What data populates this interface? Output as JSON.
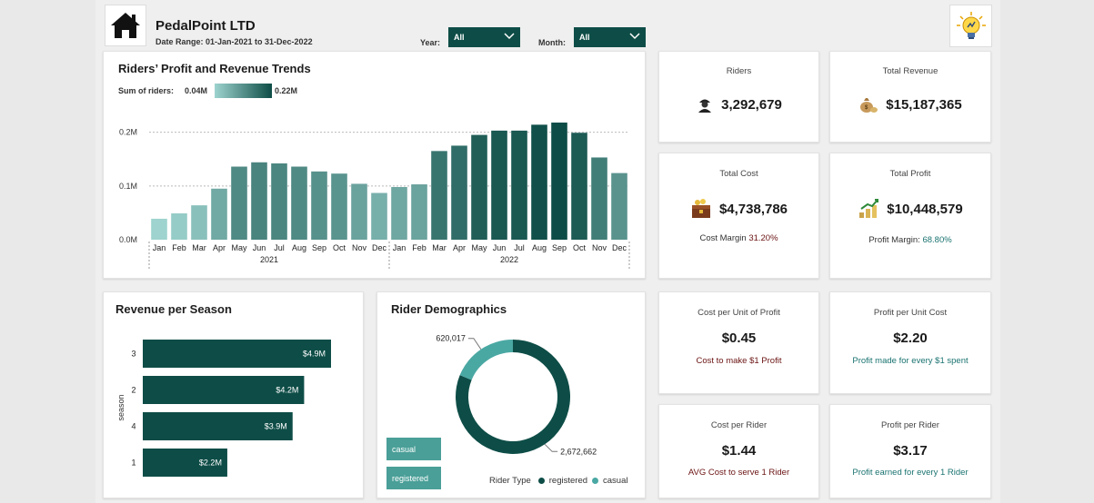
{
  "header": {
    "company": "PedalPoint LTD",
    "date_range": "Date Range: 01-Jan-2021 to 31-Dec-2022",
    "year_label": "Year:",
    "year_value": "All",
    "month_label": "Month:",
    "month_value": "All"
  },
  "trend": {
    "title": "Riders’ Profit and Revenue Trends",
    "legend_label": "Sum of riders:",
    "legend_min": "0.04M",
    "legend_max": "0.22M"
  },
  "kpis": {
    "riders": {
      "label": "Riders",
      "value": "3,292,679"
    },
    "total_revenue": {
      "label": "Total Revenue",
      "value": "$15,187,365"
    },
    "total_cost": {
      "label": "Total Cost",
      "value": "$4,738,786",
      "sub_label": "Cost Margin",
      "sub_value": "31.20%"
    },
    "total_profit": {
      "label": "Total Profit",
      "value": "$10,448,579",
      "sub_label": "Profit Margin:",
      "sub_value": "68.80%"
    },
    "cost_per_profit": {
      "label": "Cost per Unit of Profit",
      "value": "$0.45",
      "sub": "Cost to make $1 Profit"
    },
    "profit_per_cost": {
      "label": "Profit per Unit Cost",
      "value": "$2.20",
      "sub": "Profit made for every $1 spent"
    },
    "cost_per_rider": {
      "label": "Cost per Rider",
      "value": "$1.44",
      "sub": "AVG Cost to serve 1 Rider"
    },
    "profit_per_rider": {
      "label": "Profit per Rider",
      "value": "$3.17",
      "sub": "Profit earned for every 1 Rider"
    }
  },
  "season": {
    "title": "Revenue per Season",
    "axis_label": "season"
  },
  "demographics": {
    "title": "Rider Demographics",
    "buttons": [
      "casual",
      "registered"
    ],
    "legend_title": "Rider Type",
    "legend_items": [
      "registered",
      "casual"
    ]
  },
  "colors": {
    "dark_teal": "#0e4d47",
    "mid_teal": "#4a9f98",
    "light_teal": "#8fcfca",
    "teal_text": "#1a7370",
    "maroon_text": "#6b1313"
  },
  "icons": {
    "home": "home-icon",
    "bulb": "lightbulb-icon",
    "riders": "rider-icon",
    "revenue": "money-bag-icon",
    "cost": "treasure-chest-icon",
    "profit": "growth-icon"
  },
  "chart_data": [
    {
      "type": "bar",
      "title": "Riders’ Profit and Revenue Trends",
      "x": [
        "Jan",
        "Feb",
        "Mar",
        "Apr",
        "May",
        "Jun",
        "Jul",
        "Aug",
        "Sep",
        "Oct",
        "Nov",
        "Dec",
        "Jan",
        "Feb",
        "Mar",
        "Apr",
        "May",
        "Jun",
        "Jul",
        "Aug",
        "Sep",
        "Oct",
        "Nov",
        "Dec"
      ],
      "groups": [
        "2021",
        "2022"
      ],
      "values": [
        0.039,
        0.049,
        0.064,
        0.095,
        0.136,
        0.144,
        0.142,
        0.136,
        0.127,
        0.123,
        0.104,
        0.087,
        0.098,
        0.103,
        0.165,
        0.175,
        0.195,
        0.203,
        0.203,
        0.214,
        0.218,
        0.199,
        0.153,
        0.124
      ],
      "y_ticks": [
        "0.0M",
        "0.1M",
        "0.2M"
      ],
      "ylim": [
        0,
        0.245
      ],
      "grid": true
    },
    {
      "type": "bar",
      "orientation": "horizontal",
      "title": "Revenue per Season",
      "ylabel": "season",
      "categories": [
        "3",
        "2",
        "4",
        "1"
      ],
      "values": [
        4.9,
        4.2,
        3.9,
        2.2
      ],
      "labels": [
        "$4.9M",
        "$4.2M",
        "$3.9M",
        "$2.2M"
      ]
    },
    {
      "type": "pie",
      "donut": true,
      "title": "Rider Demographics",
      "labels": [
        "registered",
        "casual"
      ],
      "values": [
        2672662,
        620017
      ],
      "value_labels": [
        "2,672,662",
        "620,017"
      ],
      "legend": "bottom-right"
    }
  ]
}
